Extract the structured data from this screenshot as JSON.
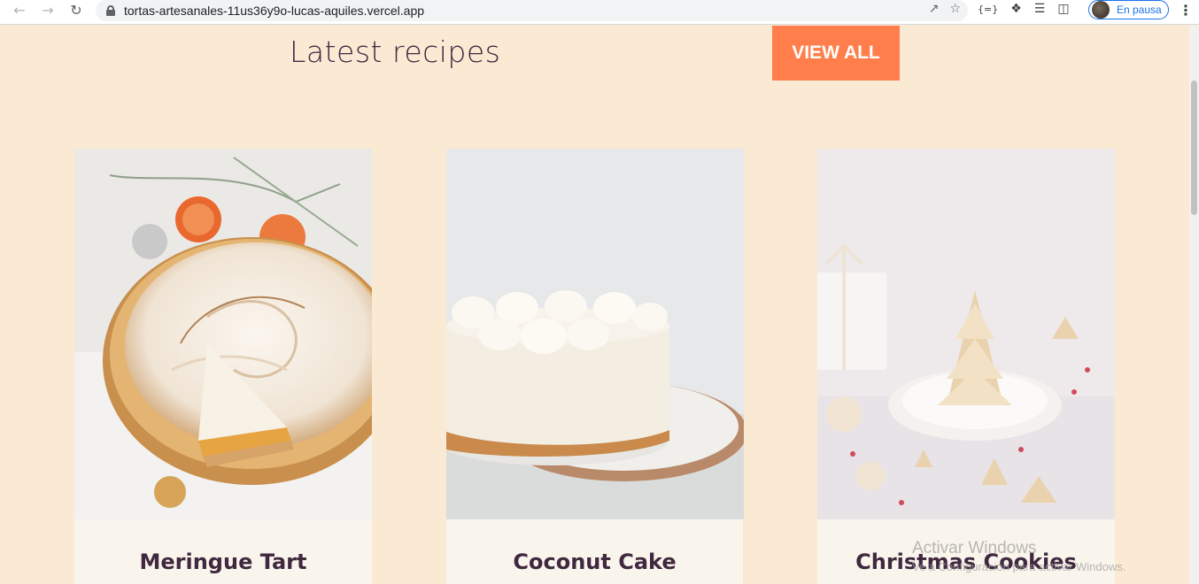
{
  "browser": {
    "url": "tortas-artesanales-11us36y9o-lucas-aquiles.vercel.app",
    "profile_label": "En pausa"
  },
  "section": {
    "title": "Latest recipes",
    "view_all_label": "VIEW ALL"
  },
  "recipes": [
    {
      "title": "Meringue Tart"
    },
    {
      "title": "Coconut Cake"
    },
    {
      "title": "Christmas Cookies"
    }
  ],
  "watermark": {
    "title": "Activar Windows",
    "subtitle": "Ve a Configuración para activar Windows."
  },
  "colors": {
    "page_bg": "#fae9d3",
    "accent": "#ff7e4b",
    "text": "#40283f",
    "card_body_bg": "#faf5ec"
  }
}
